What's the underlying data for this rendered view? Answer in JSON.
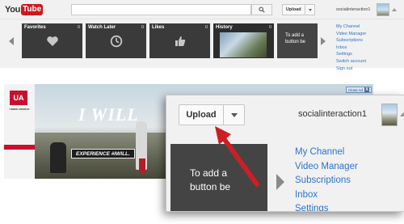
{
  "header": {
    "logo_you": "You",
    "logo_tube": "Tube",
    "search": {
      "value": "",
      "placeholder": ""
    },
    "upload_label": "Upload",
    "username": "socialinteraction1"
  },
  "guide": {
    "tiles": [
      {
        "title": "Favorites",
        "count": "0",
        "icon": "heart-icon"
      },
      {
        "title": "Watch Later",
        "count": "0",
        "icon": "clock-icon"
      },
      {
        "title": "Likes",
        "count": "0",
        "icon": "thumbs-up-icon"
      },
      {
        "title": "History",
        "count": "0",
        "icon": "video-thumbnail"
      }
    ],
    "ad_tile_text": "To add a\nbutton be",
    "account_menu": [
      "My Channel",
      "Video Manager",
      "Subscriptions",
      "Inbox",
      "Settings",
      "Switch account",
      "Sign out"
    ]
  },
  "banner": {
    "brand_text": "UNDER ARMOUR",
    "headline": "I WILL",
    "cta_label": "EXPERIENCE #IWILL.",
    "close_label": "Close Ad",
    "close_x": "X"
  },
  "zoom": {
    "upload_label": "Upload",
    "username": "socialinteraction1",
    "tile_text": "To add a\nbutton be",
    "menu": [
      "My Channel",
      "Video Manager",
      "Subscriptions",
      "Inbox",
      "Settings"
    ]
  },
  "colors": {
    "brand_red": "#cc181e",
    "link_blue": "#2e74c9",
    "annotation_red": "#cc1f24",
    "tile_dark": "#3a3a3a",
    "header_bg": "#f1f1f1"
  }
}
